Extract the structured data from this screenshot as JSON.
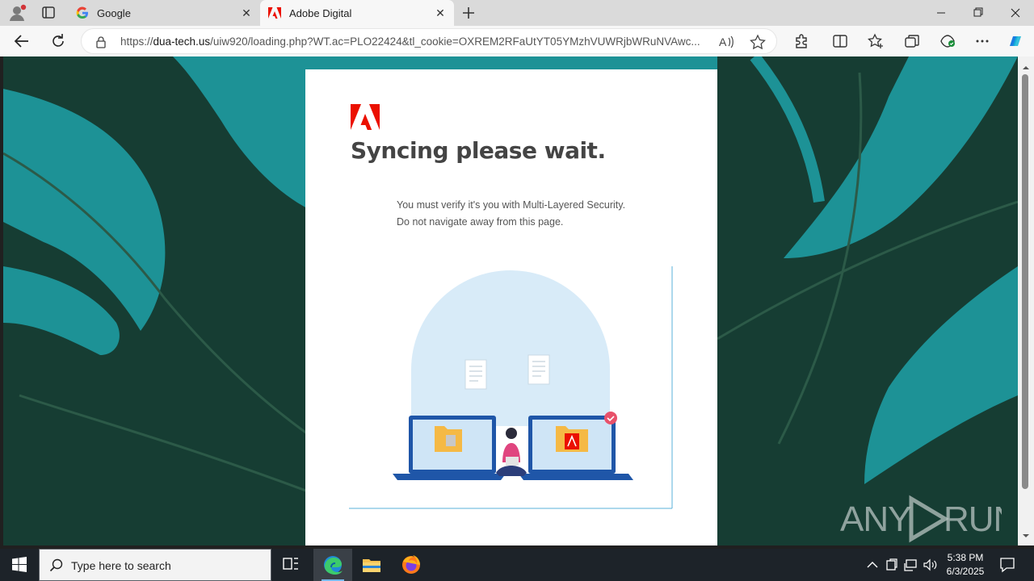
{
  "browser": {
    "tabs": [
      {
        "title": "Google",
        "favicon": "google-g-icon",
        "active": false
      },
      {
        "title": "Adobe Digital",
        "favicon": "adobe-icon",
        "active": true
      }
    ],
    "address": {
      "url_prefix": "https://",
      "url_host": "dua-tech.us",
      "url_path": "/uiw920/loading.php?WT.ac=PLO22424&tl_cookie=OXREM2RFaUtYT05YMzhVUWRjbWRuNVAwc..."
    }
  },
  "page": {
    "heading": "Syncing please wait.",
    "message_line1": "You must verify it's you with Multi-Layered Security.",
    "message_line2": "Do not navigate away from this page.",
    "illustration": "file-sync-illustration",
    "accent_color": "#eb1000"
  },
  "taskbar": {
    "search_placeholder": "Type here to search",
    "time": "5:38 PM",
    "date": "6/3/2025"
  },
  "watermark": {
    "text": "ANY RUN"
  }
}
